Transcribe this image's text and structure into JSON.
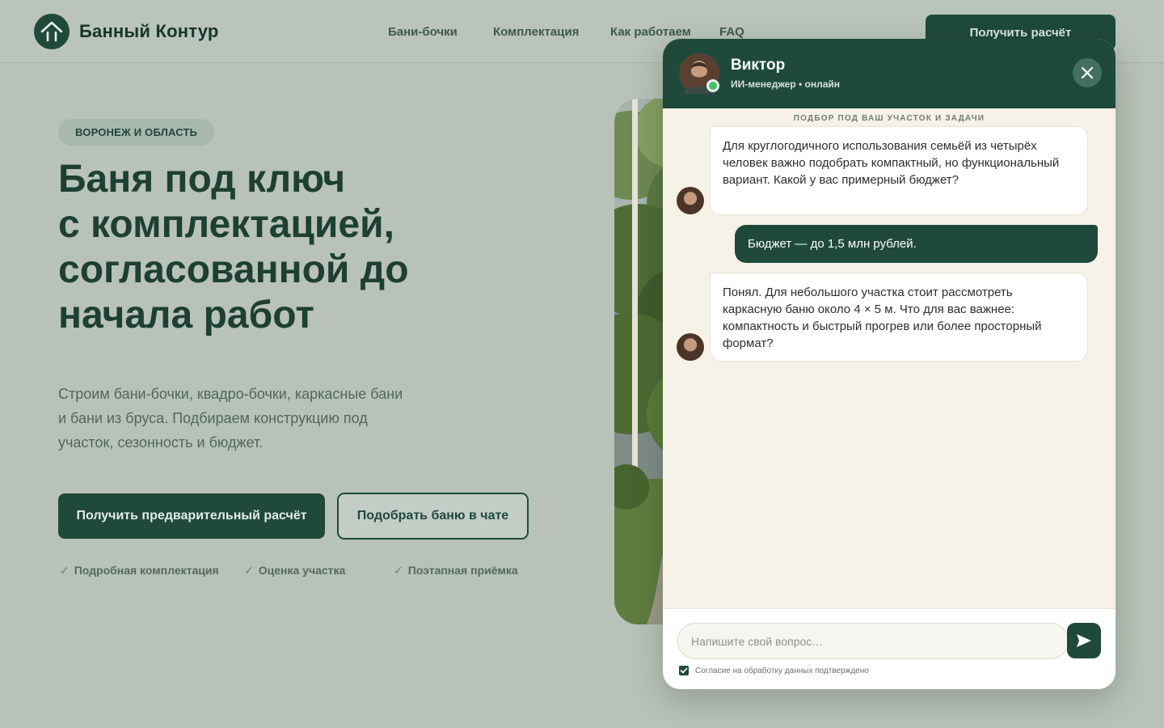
{
  "header": {
    "brand": "Банный Контур",
    "nav": [
      {
        "label": "Бани-бочки"
      },
      {
        "label": "Комплектация"
      },
      {
        "label": "Как работаем"
      },
      {
        "label": "FAQ"
      }
    ],
    "cta_label": "Получить расчёт"
  },
  "hero": {
    "region": "ВОРОНЕЖ И ОБЛАСТЬ",
    "title_lines": [
      "Баня под ключ",
      "с комплектацией,",
      "согласованной до",
      "начала работ"
    ],
    "description": "Строим бани-бочки, квадро-бочки, каркасные бани и бани из бруса. Подбираем конструкцию под участок, сезонность и бюджет.",
    "primary_button": "Получить предварительный расчёт",
    "secondary_button": "Подобрать баню в чате",
    "features": [
      {
        "check": "✓",
        "label": "Подробная комплектация"
      },
      {
        "check": "✓",
        "label": "Оценка участка"
      },
      {
        "check": "✓",
        "label": "Поэтапная приёмка"
      }
    ]
  },
  "chat": {
    "agent_name": "Виктор",
    "agent_status": "ИИ-менеджер • онлайн",
    "topic": "ПОДБОР ПОД ВАШ УЧАСТОК И ЗАДАЧИ",
    "messages": [
      {
        "from": "bot",
        "text": "Для круглогодичного использования семьёй из четырёх человек важно подобрать компактный, но функциональный вариант. Какой у вас примерный бюджет?"
      },
      {
        "from": "user",
        "text": "Бюджет — до 1,5 млн рублей."
      },
      {
        "from": "bot",
        "text": "Понял. Для небольшого участка стоит рассмотреть каркасную баню около 4 × 5 м. Что для вас важнее: компактность и быстрый прогрев или более просторный формат?"
      }
    ],
    "input_placeholder": "Напишите свой вопрос…",
    "consent": "Согласие на обработку данных подтверждено",
    "consent_checked": true
  },
  "colors": {
    "brand_green": "#1f4a3b",
    "page_bg": "#b9c2b8",
    "chat_bg": "#f6f2e8",
    "online": "#43c26b"
  },
  "icons": [
    "logo-house-icon",
    "close-icon",
    "send-icon",
    "checkmark-icon",
    "online-dot-icon"
  ]
}
